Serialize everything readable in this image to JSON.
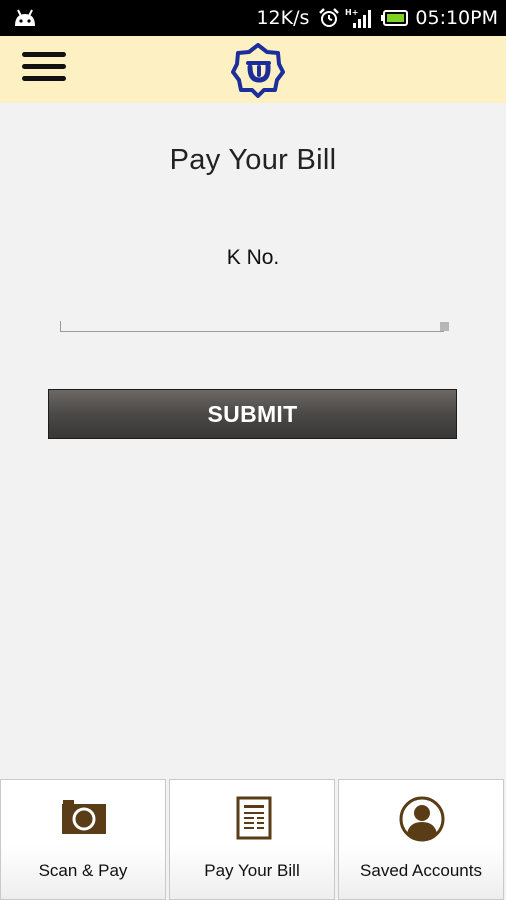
{
  "status_bar": {
    "net_speed": "12K/s",
    "network": "H+",
    "time": "05:10PM"
  },
  "header": {
    "menu_icon": "hamburger-menu-icon",
    "logo_icon": "utility-logo-icon",
    "background": "#fdf0c2"
  },
  "main": {
    "title": "Pay Your Bill",
    "field_label": "K No.",
    "field_value": "",
    "submit_label": "SUBMIT"
  },
  "bottom_nav": {
    "items": [
      {
        "label": "Scan & Pay",
        "icon": "camera-icon"
      },
      {
        "label": "Pay Your Bill",
        "icon": "bill-document-icon"
      },
      {
        "label": "Saved Accounts",
        "icon": "user-account-icon"
      }
    ],
    "icon_color": "#5a3d16"
  }
}
